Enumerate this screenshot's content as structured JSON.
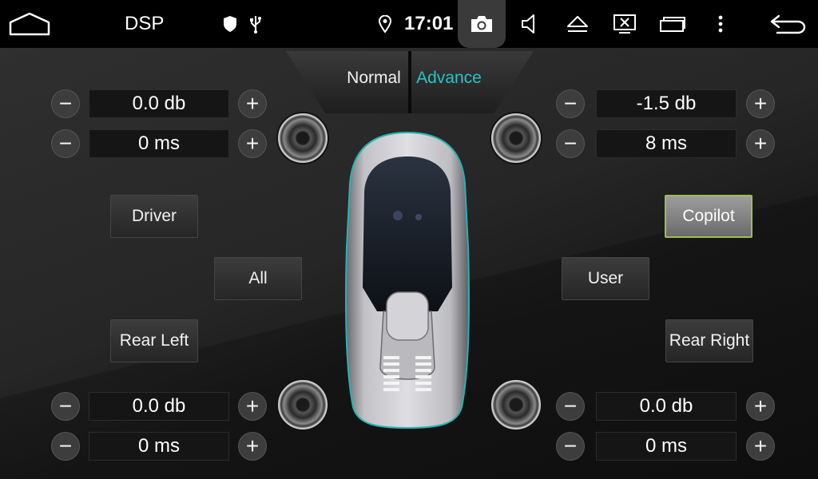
{
  "statusbar": {
    "title": "DSP",
    "time": "17:01",
    "icons": [
      "home-icon",
      "shield-icon",
      "usb-icon",
      "location-icon",
      "camera-icon",
      "volume-icon",
      "eject-icon",
      "screen-off-icon",
      "window-icon",
      "more-icon",
      "back-icon"
    ]
  },
  "modes": {
    "normal": "Normal",
    "advance": "Advance",
    "active": "advance"
  },
  "colors": {
    "accent": "#25c4c8",
    "active_border": "#9bbf58"
  },
  "channels": {
    "front_left": {
      "gain": "0.0 db",
      "delay": "0 ms"
    },
    "front_right": {
      "gain": "-1.5 db",
      "delay": "8 ms"
    },
    "rear_left": {
      "gain": "0.0 db",
      "delay": "0 ms"
    },
    "rear_right": {
      "gain": "0.0 db",
      "delay": "0 ms"
    }
  },
  "buttons": {
    "driver": "Driver",
    "copilot": "Copilot",
    "all": "All",
    "user": "User",
    "rear_left": "Rear Left",
    "rear_right": "Rear Right",
    "selected": "copilot"
  },
  "controls": {
    "minus": "−",
    "plus": "+"
  }
}
